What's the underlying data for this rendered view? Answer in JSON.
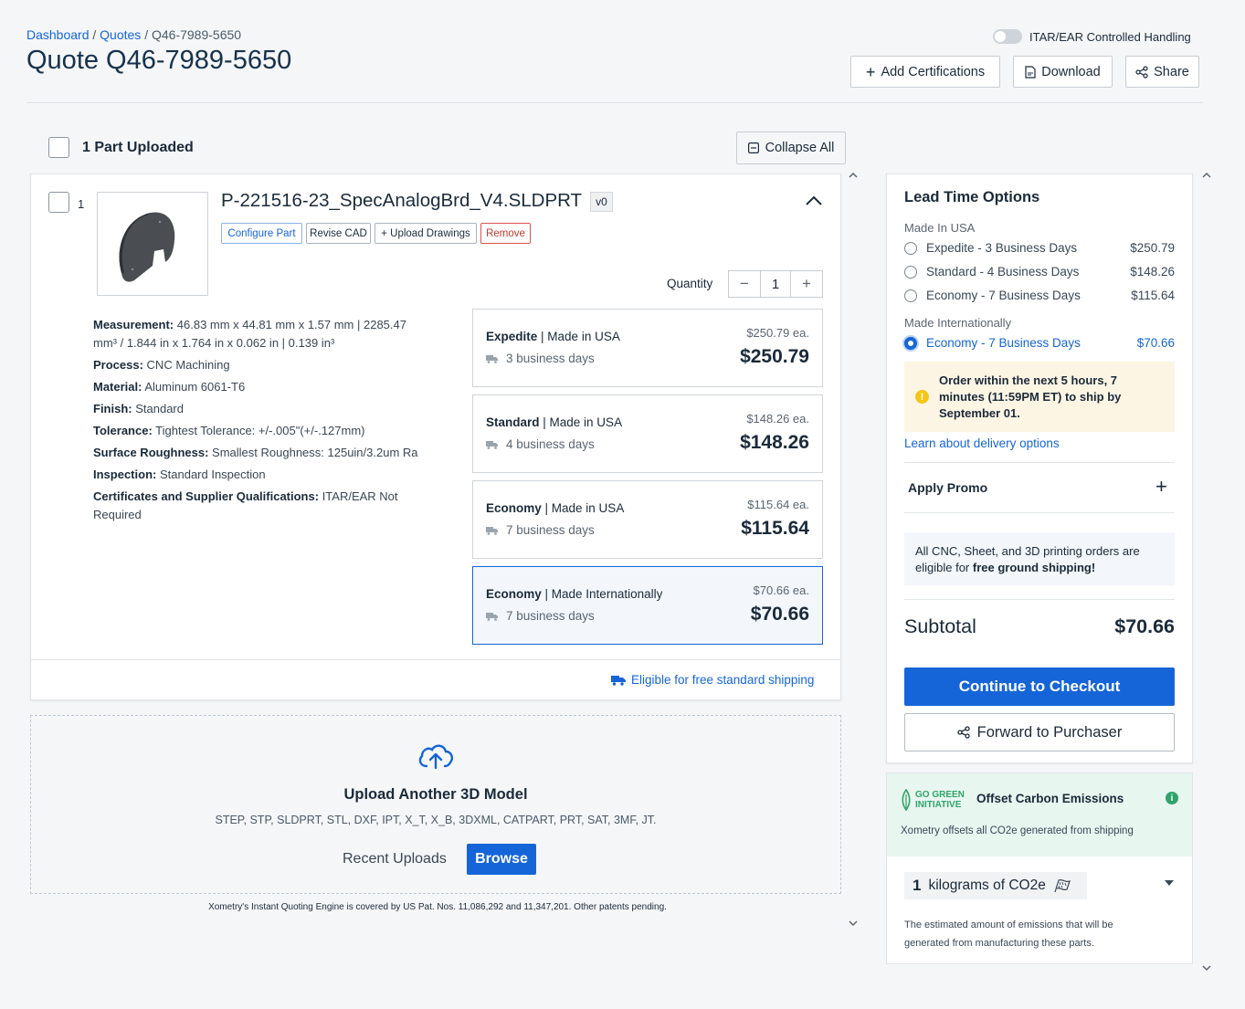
{
  "breadcrumb": {
    "dashboard": "Dashboard",
    "quotes": "Quotes",
    "current": "Q46-7989-5650",
    "sep": "/"
  },
  "page_title": "Quote Q46-7989-5650",
  "header": {
    "itar_label": "ITAR/EAR Controlled Handling",
    "add_certifications": "Add Certifications",
    "download": "Download",
    "share": "Share"
  },
  "parts": {
    "uploaded_label": "1 Part Uploaded",
    "collapse_all": "Collapse All"
  },
  "part": {
    "index": "1",
    "name": "P-221516-23_SpecAnalogBrd_V4.SLDPRT",
    "version": "v0",
    "buttons": {
      "configure": "Configure Part",
      "revise": "Revise CAD",
      "upload_drawings": "+ Upload Drawings",
      "remove": "Remove"
    },
    "quantity_label": "Quantity",
    "quantity": "1",
    "specs": [
      {
        "label": "Measurement:",
        "value": "46.83 mm x 44.81 mm x 1.57 mm | 2285.47 mm³  /  1.844 in x 1.764 in x 0.062 in | 0.139 in³"
      },
      {
        "label": "Process:",
        "value": "CNC Machining"
      },
      {
        "label": "Material:",
        "value": "Aluminum 6061-T6"
      },
      {
        "label": "Finish:",
        "value": "Standard"
      },
      {
        "label": "Tolerance:",
        "value": "Tightest Tolerance: +/-.005\"(+/-.127mm)"
      },
      {
        "label": "Surface Roughness:",
        "value": "Smallest Roughness: 125uin/3.2um Ra"
      },
      {
        "label": "Inspection:",
        "value": "Standard Inspection"
      },
      {
        "label": "Certificates and Supplier Qualifications:",
        "value": "ITAR/EAR Not Required"
      }
    ],
    "options": [
      {
        "tier": "Expedite",
        "origin": "Made in USA",
        "days": "3 business days",
        "each": "$250.79 ea.",
        "price": "$250.79"
      },
      {
        "tier": "Standard",
        "origin": "Made in USA",
        "days": "4 business days",
        "each": "$148.26 ea.",
        "price": "$148.26"
      },
      {
        "tier": "Economy",
        "origin": "Made in USA",
        "days": "7 business days",
        "each": "$115.64 ea.",
        "price": "$115.64"
      },
      {
        "tier": "Economy",
        "origin": "Made Internationally",
        "days": "7 business days",
        "each": "$70.66 ea.",
        "price": "$70.66"
      }
    ],
    "free_shipping": "Eligible for free standard shipping"
  },
  "upload": {
    "title": "Upload Another 3D Model",
    "types": "STEP, STP, SLDPRT, STL, DXF, IPT, X_T, X_B, 3DXML, CATPART, PRT, SAT, 3MF, JT.",
    "recent": "Recent Uploads",
    "browse": "Browse"
  },
  "patent": "Xometry's Instant Quoting Engine is covered by US Pat. Nos. 11,086,292 and 11,347,201. Other patents pending.",
  "lead_time": {
    "title": "Lead Time Options",
    "usa_label": "Made In USA",
    "intl_label": "Made Internationally",
    "usa": [
      {
        "name": "Expedite - 3 Business Days",
        "price": "$250.79"
      },
      {
        "name": "Standard - 4 Business Days",
        "price": "$148.26"
      },
      {
        "name": "Economy - 7 Business Days",
        "price": "$115.64"
      }
    ],
    "intl": [
      {
        "name": "Economy - 7 Business Days",
        "price": "$70.66"
      }
    ],
    "notice": "Order within the next 5 hours, 7 minutes (11:59PM ET) to ship by September 01.",
    "learn": "Learn about delivery options",
    "promo": "Apply Promo",
    "shipping_prefix": "All CNC, Sheet, and 3D printing orders are eligible for ",
    "shipping_bold": "free ground shipping!",
    "subtotal_label": "Subtotal",
    "subtotal_value": "$70.66",
    "checkout": "Continue to Checkout",
    "forward": "Forward to Purchaser"
  },
  "green": {
    "logo_line1": "GO GREEN",
    "logo_line2": "INITIATIVE",
    "title": "Offset Carbon Emissions",
    "desc": "Xometry offsets all CO2e generated from shipping",
    "amount": "1",
    "unit": "kilograms of CO2e",
    "note": "The estimated amount of emissions that will be generated from manufacturing these parts."
  },
  "colors": {
    "accent": "#1565d8",
    "green": "#2ea46b",
    "danger": "#c0392b",
    "notice": "#fdf5e4"
  }
}
